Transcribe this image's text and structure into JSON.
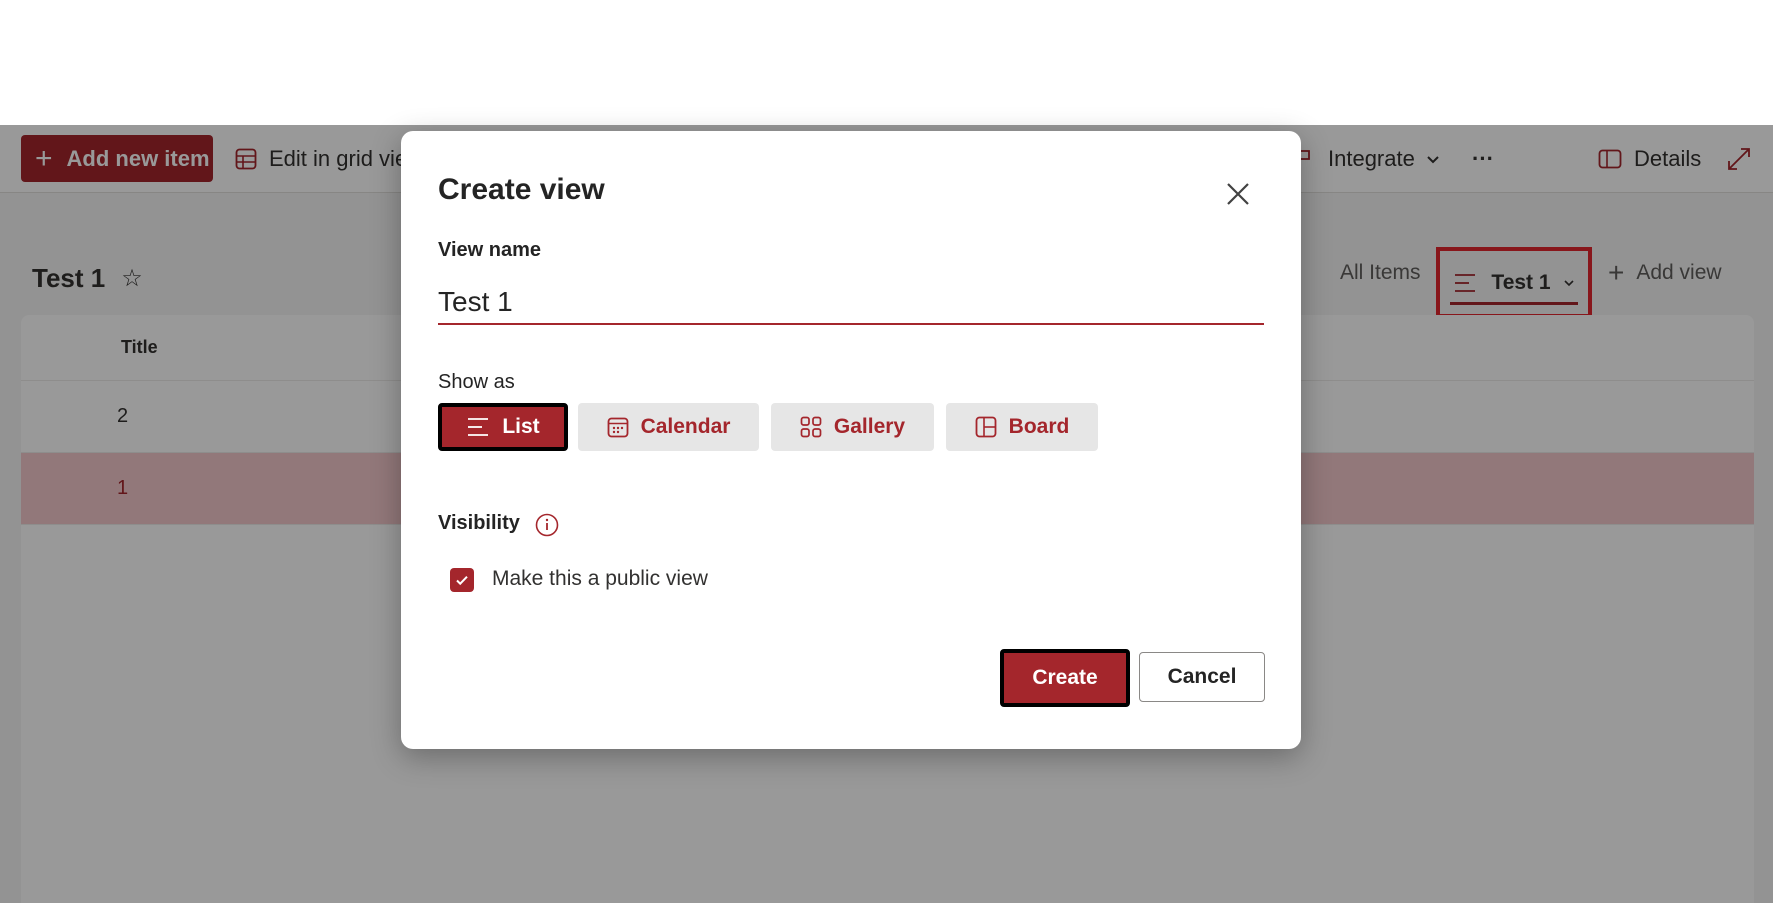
{
  "toolbar": {
    "add_new_item": "Add new item",
    "edit_grid": "Edit in grid vie",
    "integrate": "Integrate",
    "more": "···",
    "details": "Details"
  },
  "list": {
    "title": "Test 1",
    "column_title": "Title",
    "rows": [
      "2",
      "1"
    ]
  },
  "views": {
    "all_items": "All Items",
    "current": "Test 1",
    "add_view": "Add view"
  },
  "dialog": {
    "title": "Create view",
    "view_name_label": "View name",
    "view_name_value": "Test 1",
    "show_as_label": "Show as",
    "options": [
      "List",
      "Calendar",
      "Gallery",
      "Board"
    ],
    "selected_option": "List",
    "visibility_label": "Visibility",
    "public_checkbox_label": "Make this a public view",
    "public_checked": true,
    "create": "Create",
    "cancel": "Cancel"
  },
  "colors": {
    "accent": "#a4262c",
    "highlight_box": "#e3262d"
  }
}
